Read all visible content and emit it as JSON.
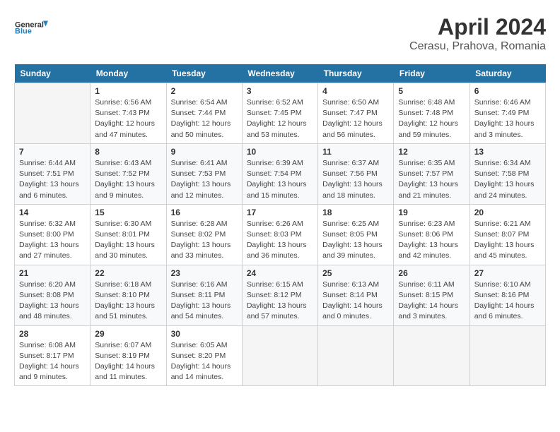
{
  "header": {
    "logo_line1": "General",
    "logo_line2": "Blue",
    "title": "April 2024",
    "subtitle": "Cerasu, Prahova, Romania"
  },
  "calendar": {
    "weekdays": [
      "Sunday",
      "Monday",
      "Tuesday",
      "Wednesday",
      "Thursday",
      "Friday",
      "Saturday"
    ],
    "weeks": [
      [
        {
          "day": "",
          "info": ""
        },
        {
          "day": "1",
          "info": "Sunrise: 6:56 AM\nSunset: 7:43 PM\nDaylight: 12 hours\nand 47 minutes."
        },
        {
          "day": "2",
          "info": "Sunrise: 6:54 AM\nSunset: 7:44 PM\nDaylight: 12 hours\nand 50 minutes."
        },
        {
          "day": "3",
          "info": "Sunrise: 6:52 AM\nSunset: 7:45 PM\nDaylight: 12 hours\nand 53 minutes."
        },
        {
          "day": "4",
          "info": "Sunrise: 6:50 AM\nSunset: 7:47 PM\nDaylight: 12 hours\nand 56 minutes."
        },
        {
          "day": "5",
          "info": "Sunrise: 6:48 AM\nSunset: 7:48 PM\nDaylight: 12 hours\nand 59 minutes."
        },
        {
          "day": "6",
          "info": "Sunrise: 6:46 AM\nSunset: 7:49 PM\nDaylight: 13 hours\nand 3 minutes."
        }
      ],
      [
        {
          "day": "7",
          "info": "Sunrise: 6:44 AM\nSunset: 7:51 PM\nDaylight: 13 hours\nand 6 minutes."
        },
        {
          "day": "8",
          "info": "Sunrise: 6:43 AM\nSunset: 7:52 PM\nDaylight: 13 hours\nand 9 minutes."
        },
        {
          "day": "9",
          "info": "Sunrise: 6:41 AM\nSunset: 7:53 PM\nDaylight: 13 hours\nand 12 minutes."
        },
        {
          "day": "10",
          "info": "Sunrise: 6:39 AM\nSunset: 7:54 PM\nDaylight: 13 hours\nand 15 minutes."
        },
        {
          "day": "11",
          "info": "Sunrise: 6:37 AM\nSunset: 7:56 PM\nDaylight: 13 hours\nand 18 minutes."
        },
        {
          "day": "12",
          "info": "Sunrise: 6:35 AM\nSunset: 7:57 PM\nDaylight: 13 hours\nand 21 minutes."
        },
        {
          "day": "13",
          "info": "Sunrise: 6:34 AM\nSunset: 7:58 PM\nDaylight: 13 hours\nand 24 minutes."
        }
      ],
      [
        {
          "day": "14",
          "info": "Sunrise: 6:32 AM\nSunset: 8:00 PM\nDaylight: 13 hours\nand 27 minutes."
        },
        {
          "day": "15",
          "info": "Sunrise: 6:30 AM\nSunset: 8:01 PM\nDaylight: 13 hours\nand 30 minutes."
        },
        {
          "day": "16",
          "info": "Sunrise: 6:28 AM\nSunset: 8:02 PM\nDaylight: 13 hours\nand 33 minutes."
        },
        {
          "day": "17",
          "info": "Sunrise: 6:26 AM\nSunset: 8:03 PM\nDaylight: 13 hours\nand 36 minutes."
        },
        {
          "day": "18",
          "info": "Sunrise: 6:25 AM\nSunset: 8:05 PM\nDaylight: 13 hours\nand 39 minutes."
        },
        {
          "day": "19",
          "info": "Sunrise: 6:23 AM\nSunset: 8:06 PM\nDaylight: 13 hours\nand 42 minutes."
        },
        {
          "day": "20",
          "info": "Sunrise: 6:21 AM\nSunset: 8:07 PM\nDaylight: 13 hours\nand 45 minutes."
        }
      ],
      [
        {
          "day": "21",
          "info": "Sunrise: 6:20 AM\nSunset: 8:08 PM\nDaylight: 13 hours\nand 48 minutes."
        },
        {
          "day": "22",
          "info": "Sunrise: 6:18 AM\nSunset: 8:10 PM\nDaylight: 13 hours\nand 51 minutes."
        },
        {
          "day": "23",
          "info": "Sunrise: 6:16 AM\nSunset: 8:11 PM\nDaylight: 13 hours\nand 54 minutes."
        },
        {
          "day": "24",
          "info": "Sunrise: 6:15 AM\nSunset: 8:12 PM\nDaylight: 13 hours\nand 57 minutes."
        },
        {
          "day": "25",
          "info": "Sunrise: 6:13 AM\nSunset: 8:14 PM\nDaylight: 14 hours\nand 0 minutes."
        },
        {
          "day": "26",
          "info": "Sunrise: 6:11 AM\nSunset: 8:15 PM\nDaylight: 14 hours\nand 3 minutes."
        },
        {
          "day": "27",
          "info": "Sunrise: 6:10 AM\nSunset: 8:16 PM\nDaylight: 14 hours\nand 6 minutes."
        }
      ],
      [
        {
          "day": "28",
          "info": "Sunrise: 6:08 AM\nSunset: 8:17 PM\nDaylight: 14 hours\nand 9 minutes."
        },
        {
          "day": "29",
          "info": "Sunrise: 6:07 AM\nSunset: 8:19 PM\nDaylight: 14 hours\nand 11 minutes."
        },
        {
          "day": "30",
          "info": "Sunrise: 6:05 AM\nSunset: 8:20 PM\nDaylight: 14 hours\nand 14 minutes."
        },
        {
          "day": "",
          "info": ""
        },
        {
          "day": "",
          "info": ""
        },
        {
          "day": "",
          "info": ""
        },
        {
          "day": "",
          "info": ""
        }
      ]
    ]
  }
}
